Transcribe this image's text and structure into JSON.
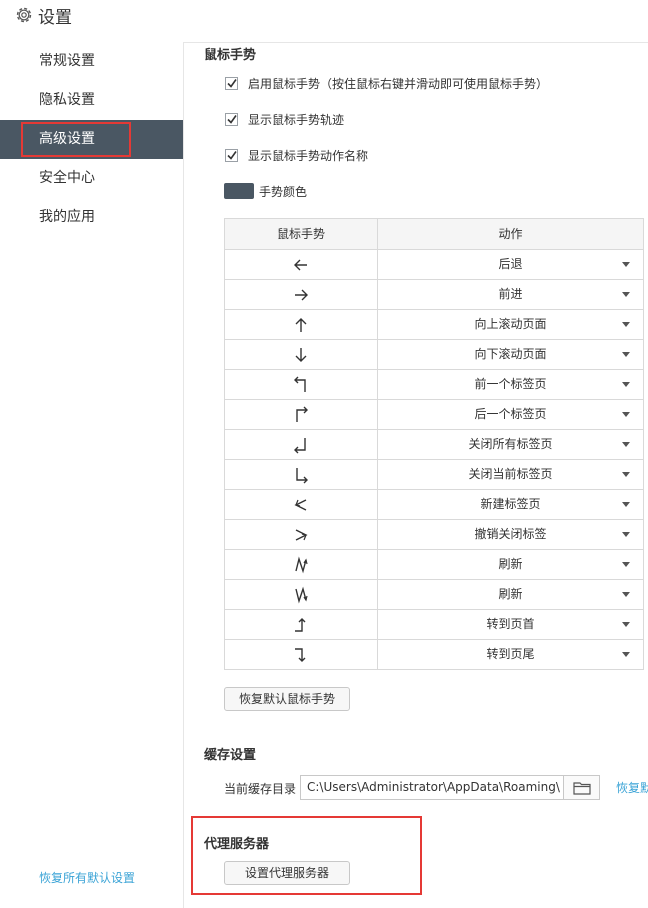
{
  "app": {
    "title": "设置",
    "icon": "gear-icon"
  },
  "sidebar": {
    "items": [
      {
        "label": "常规设置",
        "active": false
      },
      {
        "label": "隐私设置",
        "active": false
      },
      {
        "label": "高级设置",
        "active": true
      },
      {
        "label": "安全中心",
        "active": false
      },
      {
        "label": "我的应用",
        "active": false
      }
    ],
    "restore_all": "恢复所有默认设置"
  },
  "gesture": {
    "title": "鼠标手势",
    "options": [
      {
        "label": "启用鼠标手势（按住鼠标右键并滑动即可使用鼠标手势）",
        "checked": true
      },
      {
        "label": "显示鼠标手势轨迹",
        "checked": true
      },
      {
        "label": "显示鼠标手势动作名称",
        "checked": true
      }
    ],
    "color_label": "手势颜色",
    "color": "#4a5763",
    "table": {
      "headers": [
        "鼠标手势",
        "动作"
      ],
      "rows": [
        {
          "gesture": "left-arrow-icon",
          "action": "后退"
        },
        {
          "gesture": "right-arrow-icon",
          "action": "前进"
        },
        {
          "gesture": "up-arrow-icon",
          "action": "向上滚动页面"
        },
        {
          "gesture": "down-arrow-icon",
          "action": "向下滚动页面"
        },
        {
          "gesture": "up-left-gesture-icon",
          "action": "前一个标签页"
        },
        {
          "gesture": "up-right-gesture-icon",
          "action": "后一个标签页"
        },
        {
          "gesture": "down-left-gesture-icon",
          "action": "关闭所有标签页"
        },
        {
          "gesture": "down-right-gesture-icon",
          "action": "关闭当前标签页"
        },
        {
          "gesture": "left-zigzag-gesture-icon",
          "action": "新建标签页"
        },
        {
          "gesture": "right-zigzag-gesture-icon",
          "action": "撤销关闭标签"
        },
        {
          "gesture": "up-down-up-gesture-icon",
          "action": "刷新"
        },
        {
          "gesture": "down-up-down-gesture-icon",
          "action": "刷新"
        },
        {
          "gesture": "right-up-gesture-icon",
          "action": "转到页首"
        },
        {
          "gesture": "right-down-gesture-icon",
          "action": "转到页尾"
        }
      ]
    },
    "restore_button": "恢复默认鼠标手势"
  },
  "cache": {
    "title": "缓存设置",
    "dir_label": "当前缓存目录",
    "dir_value": "C:\\Users\\Administrator\\AppData\\Roaming\\",
    "restore_link": "恢复默"
  },
  "proxy": {
    "title": "代理服务器",
    "button": "设置代理服务器"
  }
}
